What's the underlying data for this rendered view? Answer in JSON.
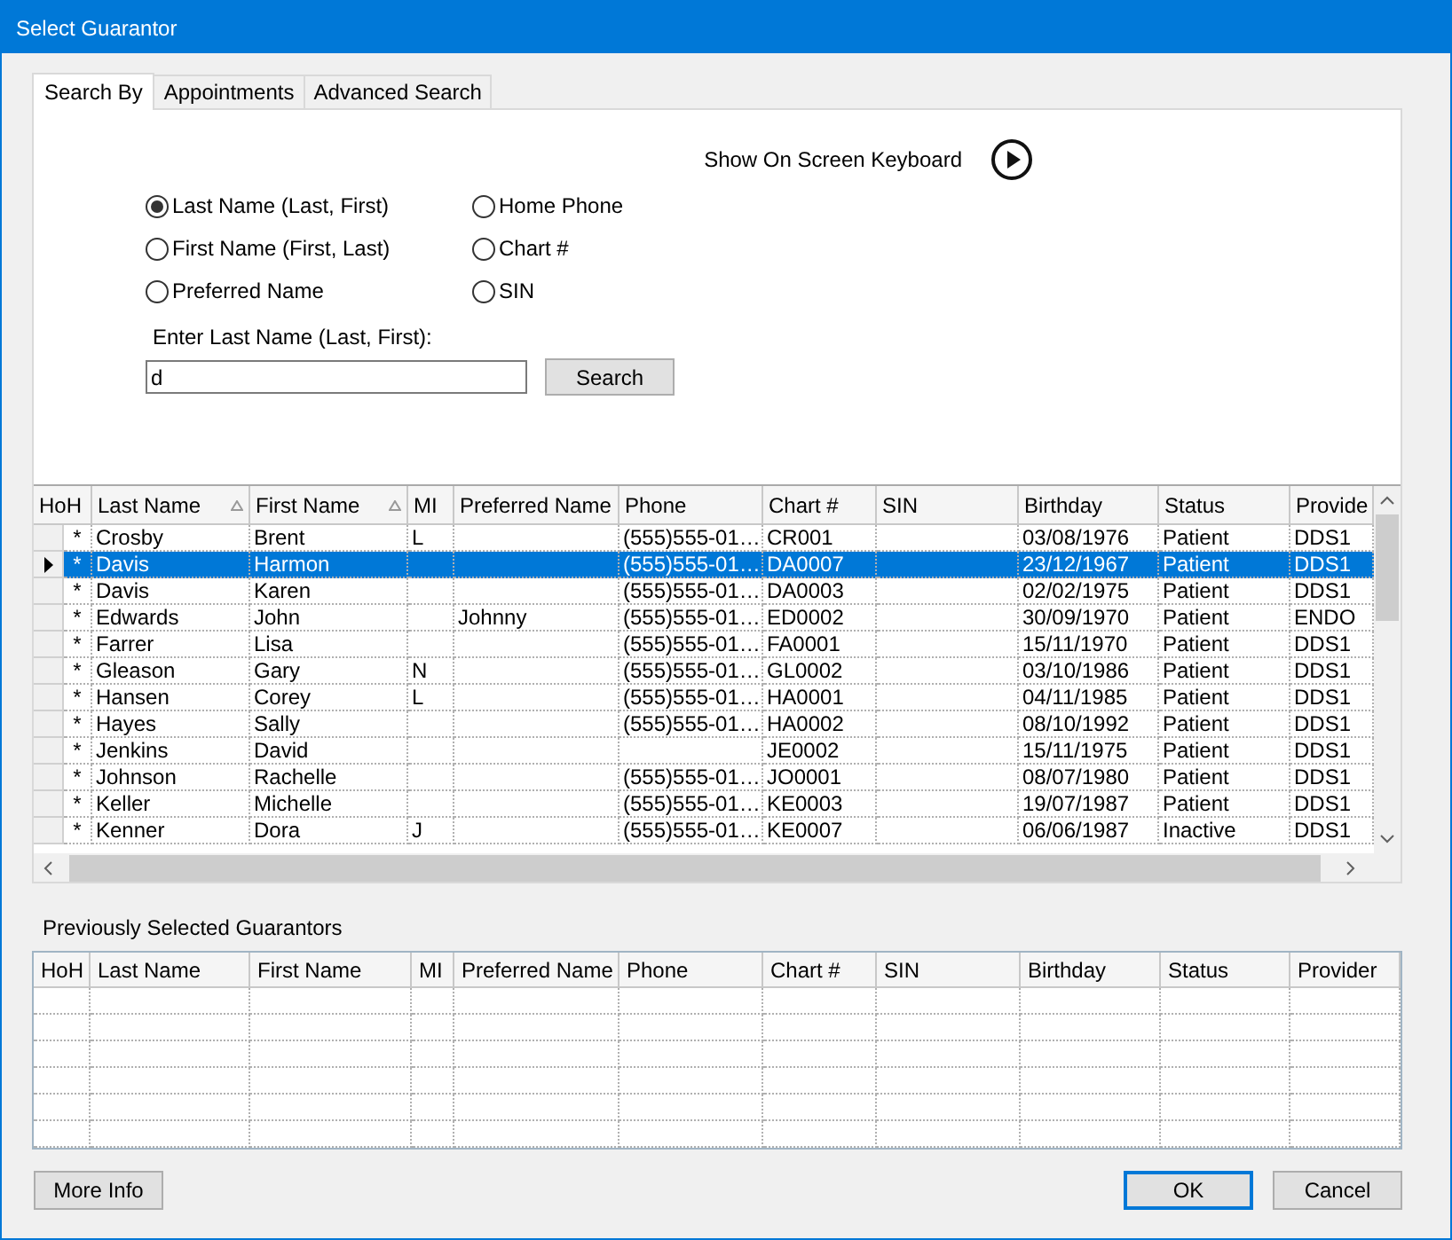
{
  "window": {
    "title": "Select Guarantor"
  },
  "tabs": [
    {
      "label": "Search By",
      "selected": true
    },
    {
      "label": "Appointments",
      "selected": false
    },
    {
      "label": "Advanced Search",
      "selected": false
    }
  ],
  "keyboard": {
    "label": "Show On Screen Keyboard"
  },
  "search_options": [
    {
      "label": "Last Name (Last, First)",
      "selected": true
    },
    {
      "label": "First Name (First, Last)",
      "selected": false
    },
    {
      "label": "Preferred Name",
      "selected": false
    },
    {
      "label": "Home Phone",
      "selected": false
    },
    {
      "label": "Chart #",
      "selected": false
    },
    {
      "label": "SIN",
      "selected": false
    }
  ],
  "search_field": {
    "label": "Enter Last Name (Last, First):",
    "value": "d"
  },
  "search_button": "Search",
  "results": {
    "columns": [
      {
        "label": "HoH",
        "sorted": false
      },
      {
        "label": "Last Name",
        "sorted": true
      },
      {
        "label": "First Name",
        "sorted": true
      },
      {
        "label": "MI",
        "sorted": false
      },
      {
        "label": "Preferred Name",
        "sorted": false
      },
      {
        "label": "Phone",
        "sorted": false
      },
      {
        "label": "Chart #",
        "sorted": false
      },
      {
        "label": "SIN",
        "sorted": false
      },
      {
        "label": "Birthday",
        "sorted": false
      },
      {
        "label": "Status",
        "sorted": false
      },
      {
        "label": "Provide",
        "sorted": false
      }
    ],
    "rows": [
      {
        "selected": false,
        "hoh": "*",
        "last_name": "Crosby",
        "first_name": "Brent",
        "mi": "L",
        "phone": "(555)555-01…",
        "chart": "CR001",
        "birthday": "03/08/1976",
        "status": "Patient",
        "provider": "DDS1"
      },
      {
        "selected": true,
        "hoh": "*",
        "last_name": "Davis",
        "first_name": "Harmon",
        "phone": "(555)555-01…",
        "chart": "DA0007",
        "birthday": "23/12/1967",
        "status": "Patient",
        "provider": "DDS1"
      },
      {
        "selected": false,
        "hoh": "*",
        "last_name": "Davis",
        "first_name": "Karen",
        "phone": "(555)555-01…",
        "chart": "DA0003",
        "birthday": "02/02/1975",
        "status": "Patient",
        "provider": "DDS1"
      },
      {
        "selected": false,
        "hoh": "*",
        "last_name": "Edwards",
        "first_name": "John",
        "preferred_name": "Johnny",
        "phone": "(555)555-01…",
        "chart": "ED0002",
        "birthday": "30/09/1970",
        "status": "Patient",
        "provider": "ENDO"
      },
      {
        "selected": false,
        "hoh": "*",
        "last_name": "Farrer",
        "first_name": "Lisa",
        "phone": "(555)555-01…",
        "chart": "FA0001",
        "birthday": "15/11/1970",
        "status": "Patient",
        "provider": "DDS1"
      },
      {
        "selected": false,
        "hoh": "*",
        "last_name": "Gleason",
        "first_name": "Gary",
        "mi": "N",
        "phone": "(555)555-01…",
        "chart": "GL0002",
        "birthday": "03/10/1986",
        "status": "Patient",
        "provider": "DDS1"
      },
      {
        "selected": false,
        "hoh": "*",
        "last_name": "Hansen",
        "first_name": "Corey",
        "mi": "L",
        "phone": "(555)555-01…",
        "chart": "HA0001",
        "birthday": "04/11/1985",
        "status": "Patient",
        "provider": "DDS1"
      },
      {
        "selected": false,
        "hoh": "*",
        "last_name": "Hayes",
        "first_name": "Sally",
        "phone": "(555)555-01…",
        "chart": "HA0002",
        "birthday": "08/10/1992",
        "status": "Patient",
        "provider": "DDS1"
      },
      {
        "selected": false,
        "hoh": "*",
        "last_name": "Jenkins",
        "first_name": "David",
        "chart": "JE0002",
        "birthday": "15/11/1975",
        "status": "Patient",
        "provider": "DDS1"
      },
      {
        "selected": false,
        "hoh": "*",
        "last_name": "Johnson",
        "first_name": "Rachelle",
        "phone": "(555)555-01…",
        "chart": "JO0001",
        "birthday": "08/07/1980",
        "status": "Patient",
        "provider": "DDS1"
      },
      {
        "selected": false,
        "hoh": "*",
        "last_name": "Keller",
        "first_name": "Michelle",
        "phone": "(555)555-01…",
        "chart": "KE0003",
        "birthday": "19/07/1987",
        "status": "Patient",
        "provider": "DDS1"
      },
      {
        "selected": false,
        "hoh": "*",
        "last_name": "Kenner",
        "first_name": "Dora",
        "mi": "J",
        "phone": "(555)555-01…",
        "chart": "KE0007",
        "birthday": "06/06/1987",
        "status": "Inactive",
        "provider": "DDS1"
      }
    ]
  },
  "previous": {
    "title": "Previously Selected Guarantors",
    "columns": [
      "HoH",
      "Last Name",
      "First Name",
      "MI",
      "Preferred Name",
      "Phone",
      "Chart #",
      "SIN",
      "Birthday",
      "Status",
      "Provider"
    ]
  },
  "buttons": [
    {
      "label": "More Info",
      "kind": "secondary"
    },
    {
      "label": "OK",
      "kind": "default"
    },
    {
      "label": "Cancel",
      "kind": "secondary"
    }
  ]
}
